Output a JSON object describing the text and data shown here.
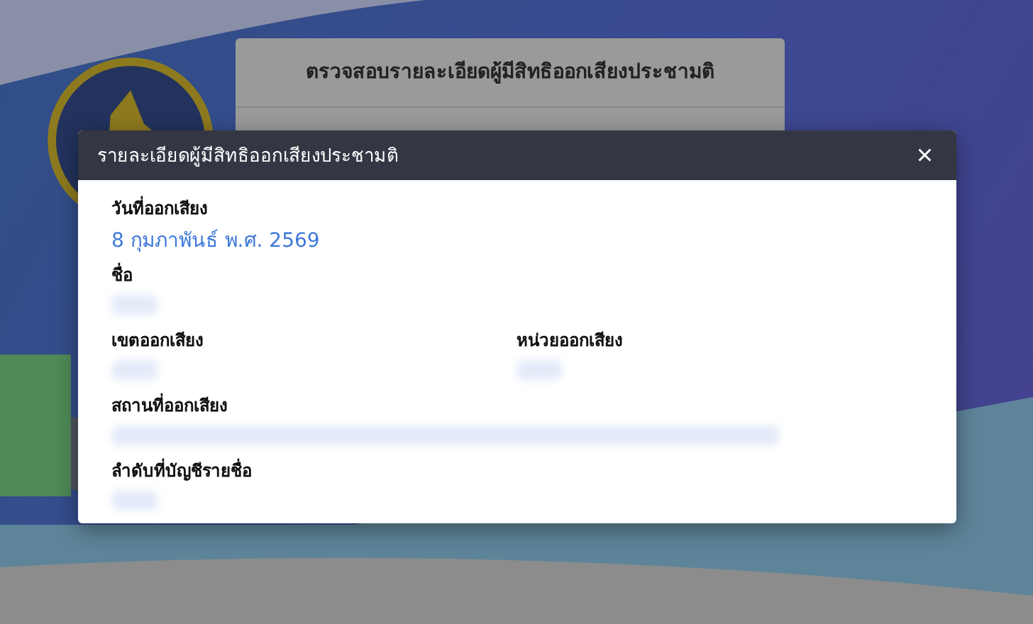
{
  "background_page": {
    "title": "ตรวจสอบรายละเอียดผู้มีสิทธิออกเสียงประชามติ"
  },
  "modal": {
    "title": "รายละเอียดผู้มีสิทธิออกเสียงประชามติ",
    "close": "×",
    "rows": [
      [
        {
          "label": "วันที่ออกเสียง",
          "kind": "text",
          "value": "8 กุมภาพันธ์ พ.ศ. 2569"
        }
      ],
      [
        {
          "label": "ชื่อ",
          "kind": "redacted"
        }
      ],
      [
        {
          "label": "เขตออกเสียง",
          "kind": "redacted"
        },
        {
          "label": "หน่วยออกเสียง",
          "kind": "redacted"
        }
      ],
      [
        {
          "label": "สถานที่ออกเสียง",
          "kind": "redacted_long"
        }
      ],
      [
        {
          "label": "ลำดับที่บัญชีรายชื่อ",
          "kind": "redacted"
        }
      ]
    ]
  }
}
